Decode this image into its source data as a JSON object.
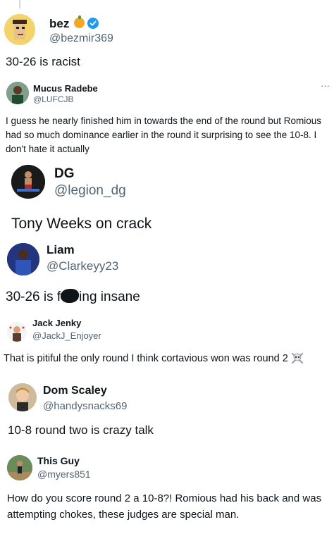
{
  "posts": [
    {
      "name": "bez",
      "handle": "@bezmir369",
      "text": "30-26 is racist",
      "badges": [
        "orange-emoji",
        "verified-check"
      ]
    },
    {
      "name": "Mucus Radebe",
      "handle": "@LUFCJB",
      "text": "I guess he nearly finished him in towards the end of the round but Romious had so much dominance earlier in the round it surprising to see the 10-8. I don't hate it actually",
      "more": "···"
    },
    {
      "name": "DG",
      "handle": "@legion_dg",
      "text": "Tony Weeks on crack"
    },
    {
      "name": "Liam",
      "handle": "@Clarkeyy23",
      "text_before": "30-26 is f",
      "text_after": "ing insane"
    },
    {
      "name": "Jack Jenky",
      "handle": "@JackJ_Enjoyer",
      "text": "That is pitiful the only round I think cortavious won was round 2",
      "emoji": "skull-crossbones"
    },
    {
      "name": "Dom Scaley",
      "handle": "@handysnacks69",
      "text": "10-8 round two is crazy talk"
    },
    {
      "name": "This Guy",
      "handle": "@myers851",
      "text": "How do you score round 2 a 10-8?! Romious had his back and was attempting chokes, these judges are special man."
    }
  ],
  "colors": {
    "text": "#0f1419",
    "secondary": "#536471",
    "verified": "#1d9bf0",
    "orange": "#f5a623"
  }
}
